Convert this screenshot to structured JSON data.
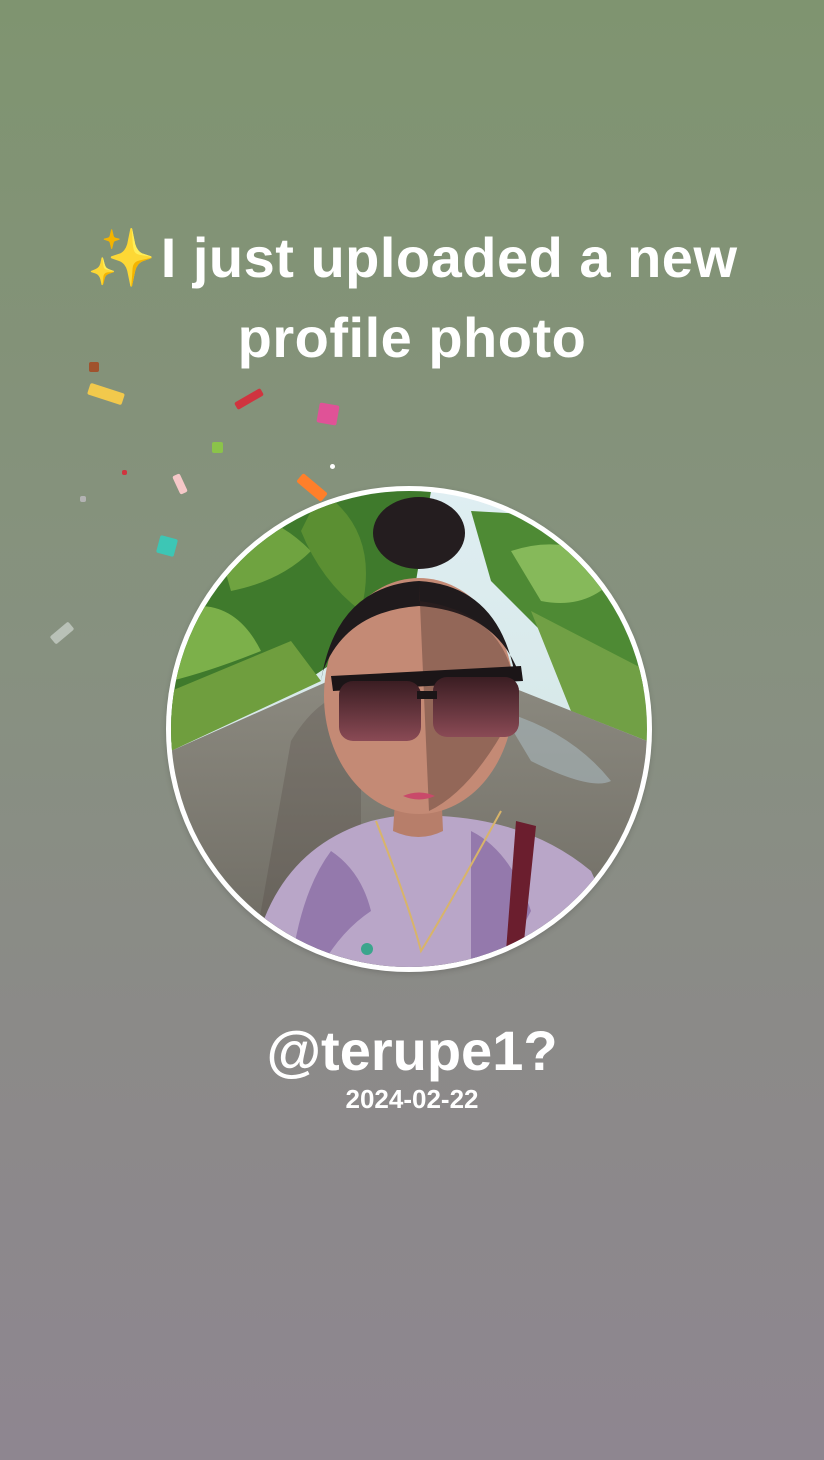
{
  "story": {
    "sparkle_icon": "✨",
    "headline": "I just uploaded a new profile photo",
    "username": "@terupe1?",
    "date": "2024-02-22",
    "profile_photo": {
      "subject": "woman-with-sunglasses-selfie"
    }
  },
  "colors": {
    "background_top": "#7f9470",
    "background_bottom": "#8e8690",
    "text": "#ffffff",
    "ring": "#ffffff"
  },
  "confetti": [
    {
      "color": "#f2c94c"
    },
    {
      "color": "#a0522d"
    },
    {
      "color": "#d0343f"
    },
    {
      "color": "#e05297"
    },
    {
      "color": "#8bc34a"
    },
    {
      "color": "#ff7f2a"
    },
    {
      "color": "#f6c8c8"
    },
    {
      "color": "#3dc6b5"
    },
    {
      "color": "#2f6fc5"
    },
    {
      "color": "#cfd6cf"
    },
    {
      "color": "#e84a5f"
    },
    {
      "color": "#ffffff"
    },
    {
      "color": "#8fd6e8"
    },
    {
      "color": "#b3b3b3"
    }
  ]
}
